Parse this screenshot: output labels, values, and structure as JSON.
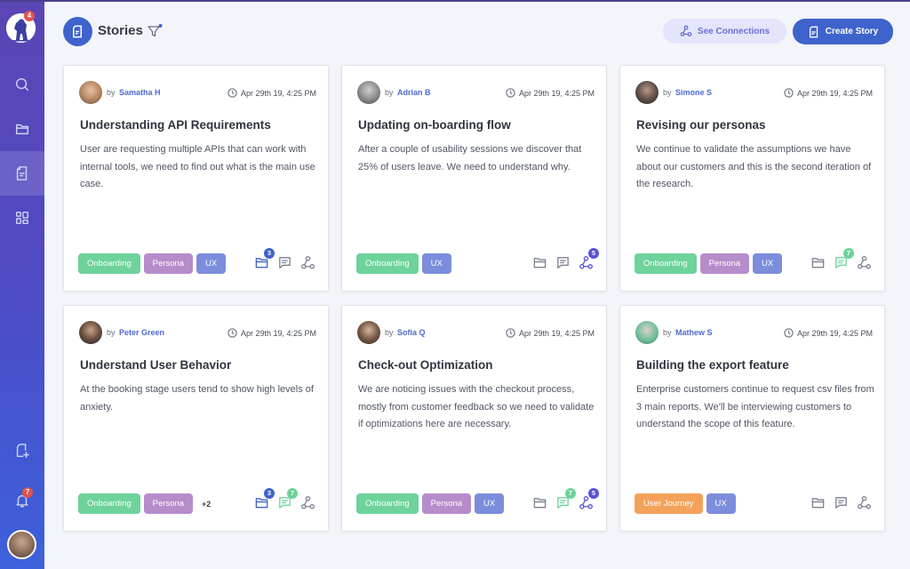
{
  "app": {
    "logo_badge": "4",
    "notifications_badge": "7"
  },
  "sidebar": {
    "items": [
      {
        "name": "search",
        "icon": "search-icon",
        "active": false
      },
      {
        "name": "folders",
        "icon": "folder-icon",
        "active": false
      },
      {
        "name": "stories",
        "icon": "document-icon",
        "active": true
      },
      {
        "name": "dashboard",
        "icon": "grid-icon",
        "active": false
      }
    ],
    "bottom": [
      {
        "name": "add-document",
        "icon": "document-plus-icon"
      },
      {
        "name": "notifications",
        "icon": "bell-icon",
        "badge": "7"
      }
    ]
  },
  "header": {
    "title": "Stories",
    "filter_icon": "filter-icon",
    "see_connections_label": "See Connections",
    "create_story_label": "Create Story"
  },
  "colors": {
    "primary": "#3f63cc",
    "sidebar": "#5149c2",
    "tag_onboarding": "#6dd39a",
    "tag_persona": "#b78ccb",
    "tag_ux": "#7b8ddb",
    "tag_user_journey": "#f4a25a",
    "count_blue": "#3f63cc",
    "count_green": "#6dd39a",
    "count_purple": "#5b54d6"
  },
  "stories": [
    {
      "by_prefix": "by",
      "author": "Samatha H",
      "time": "Apr 29th 19, 4:25 PM",
      "title": "Understanding API Requirements",
      "description": "User are requesting multiple APIs that can work with internal tools, we need to find out what is the main use case.",
      "tags": [
        "Onboarding",
        "Persona",
        "UX"
      ],
      "more": "",
      "folder_count": "3",
      "comment_count": "",
      "connection_count": ""
    },
    {
      "by_prefix": "by",
      "author": "Adrian B",
      "time": "Apr 29th 19, 4:25 PM",
      "title": "Updating on-boarding flow",
      "description": "After a couple of usability sessions we discover that 25% of users leave. We need to understand why.",
      "tags": [
        "Onboarding",
        "UX"
      ],
      "more": "",
      "folder_count": "",
      "comment_count": "",
      "connection_count": "5"
    },
    {
      "by_prefix": "by",
      "author": "Simone S",
      "time": "Apr 29th 19, 4:25 PM",
      "title": "Revising our personas",
      "description": "We continue to validate the assumptions we have about our customers and this is the second iteration of the research.",
      "tags": [
        "Onboarding",
        "Persona",
        "UX"
      ],
      "more": "",
      "folder_count": "",
      "comment_count": "7",
      "connection_count": ""
    },
    {
      "by_prefix": "by",
      "author": "Peter Green",
      "time": "Apr 29th 19, 4:25 PM",
      "title": "Understand User Behavior",
      "description": "At the booking stage users tend to show high levels of anxiety.",
      "tags": [
        "Onboarding",
        "Persona"
      ],
      "more": "+2",
      "folder_count": "3",
      "comment_count": "7",
      "connection_count": ""
    },
    {
      "by_prefix": "by",
      "author": "Sofia Q",
      "time": "Apr 29th 19, 4:25 PM",
      "title": "Check-out Optimization",
      "description": "We are noticing issues with the checkout process, mostly from customer feedback so we need to validate if optimizations here are necessary.",
      "tags": [
        "Onboarding",
        "Persona",
        "UX"
      ],
      "more": "",
      "folder_count": "",
      "comment_count": "7",
      "connection_count": "5"
    },
    {
      "by_prefix": "by",
      "author": "Mathew S",
      "time": "Apr 29th 19, 4:25 PM",
      "title": "Building the export feature",
      "description": "Enterprise customers continue to request csv files from 3 main reports. We'll be interviewing customers to understand the scope of this feature.",
      "tags": [
        "User Journey",
        "UX"
      ],
      "more": "",
      "folder_count": "",
      "comment_count": "",
      "connection_count": ""
    }
  ]
}
